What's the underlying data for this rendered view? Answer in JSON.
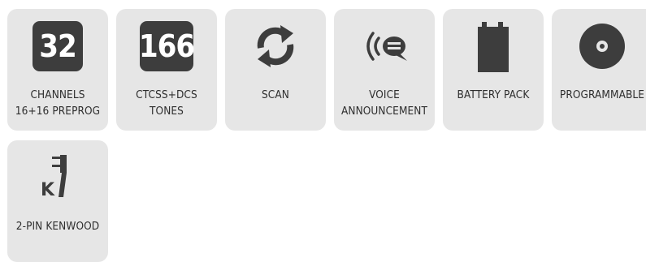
{
  "features": [
    {
      "id": "channels",
      "icon": "channels-32-icon",
      "badge": "32",
      "lines": [
        "CHANNELS",
        "16+16 PREPROG"
      ]
    },
    {
      "id": "tones",
      "icon": "tones-166-icon",
      "badge": "166",
      "lines": [
        "CTCSS+DCS",
        "TONES"
      ]
    },
    {
      "id": "scan",
      "icon": "scan-arrows-icon",
      "lines": [
        "SCAN"
      ]
    },
    {
      "id": "voice",
      "icon": "voice-announcement-icon",
      "lines": [
        "VOICE",
        "ANNOUNCEMENT"
      ]
    },
    {
      "id": "battery",
      "icon": "battery-pack-icon",
      "lines": [
        "BATTERY PACK"
      ]
    },
    {
      "id": "programmable",
      "icon": "cd-disc-icon",
      "lines": [
        "PROGRAMMABLE"
      ]
    },
    {
      "id": "kenwood",
      "icon": "kenwood-plug-icon",
      "lines": [
        "2-PIN KENWOOD"
      ]
    }
  ],
  "colors": {
    "tile": "#e6e6e6",
    "icon": "#3d3d3d",
    "text": "#2e2e2e"
  }
}
